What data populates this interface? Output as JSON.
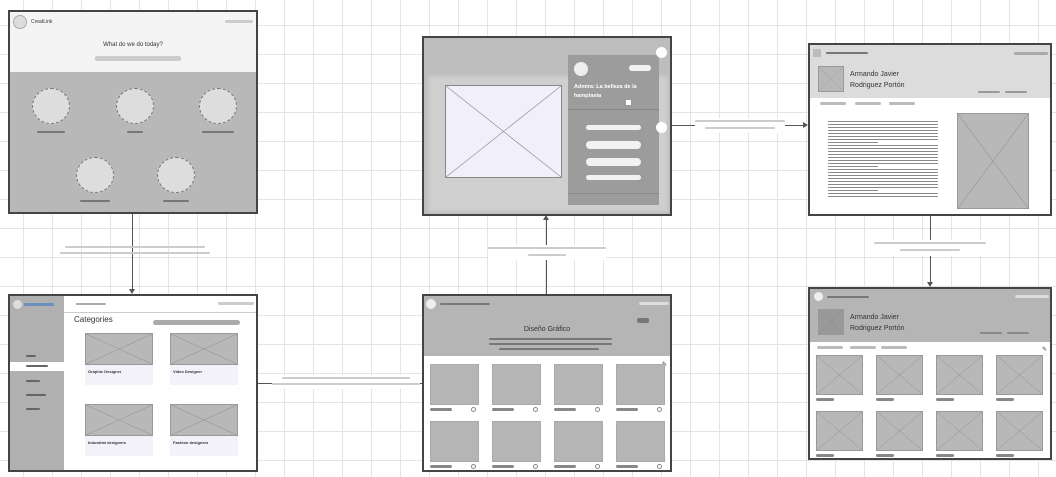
{
  "home": {
    "brand": "CreatLink",
    "question": "What do we do today?"
  },
  "categories": {
    "title": "Categories",
    "cards": [
      "Graphic Designer",
      "Video Designer",
      "Industrial designers",
      "Fashion designers"
    ]
  },
  "category_page": {
    "title": "Diseño Gráfico"
  },
  "modal": {
    "title": "Admira: La belleza de la hamplasta"
  },
  "profile": {
    "name_line1": "Armando Javier",
    "name_line2": "Rodriguez Portón"
  },
  "colors": {
    "frame_border": "#444444",
    "placeholder": "#b8b8b8",
    "sidebar": "#b0b0b0",
    "connector": "#555555"
  }
}
